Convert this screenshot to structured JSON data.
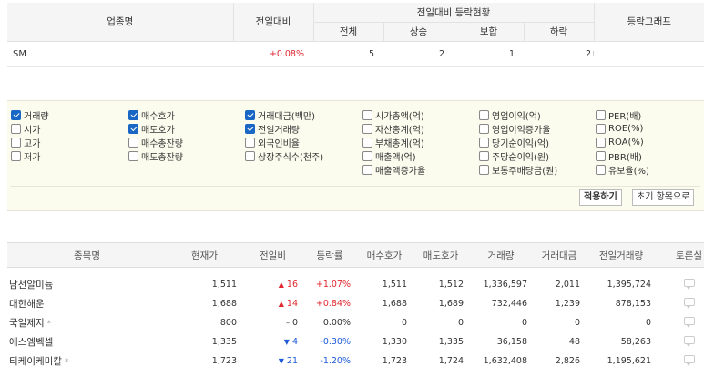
{
  "industry_table": {
    "headers": {
      "name": "업종명",
      "change": "전일대비",
      "group": "전일대비 등락현황",
      "total": "전체",
      "up": "상승",
      "flat": "보합",
      "down": "하락",
      "graph": "등락그래프"
    },
    "row": {
      "name": "SM",
      "change": "+0.08%",
      "total": "5",
      "up": "2",
      "flat": "1",
      "down": "2"
    }
  },
  "options": {
    "columns": [
      [
        {
          "label": "거래량",
          "checked": true
        },
        {
          "label": "시가",
          "checked": false
        },
        {
          "label": "고가",
          "checked": false
        },
        {
          "label": "저가",
          "checked": false
        }
      ],
      [
        {
          "label": "매수호가",
          "checked": true
        },
        {
          "label": "매도호가",
          "checked": true
        },
        {
          "label": "매수총잔량",
          "checked": false
        },
        {
          "label": "매도총잔량",
          "checked": false
        }
      ],
      [
        {
          "label": "거래대금(백만)",
          "checked": true
        },
        {
          "label": "전일거래량",
          "checked": true
        },
        {
          "label": "외국인비율",
          "checked": false
        },
        {
          "label": "상장주식수(천주)",
          "checked": false
        }
      ],
      [
        {
          "label": "시가총액(억)",
          "checked": false
        },
        {
          "label": "자산총계(억)",
          "checked": false
        },
        {
          "label": "부채총계(억)",
          "checked": false
        },
        {
          "label": "매출액(억)",
          "checked": false
        },
        {
          "label": "매출액증가율",
          "checked": false
        }
      ],
      [
        {
          "label": "영업이익(억)",
          "checked": false
        },
        {
          "label": "영업이익증가율",
          "checked": false
        },
        {
          "label": "당기순이익(억)",
          "checked": false
        },
        {
          "label": "주당순이익(원)",
          "checked": false
        },
        {
          "label": "보통주배당금(원)",
          "checked": false
        }
      ],
      [
        {
          "label": "PER(배)",
          "checked": false
        },
        {
          "label": "ROE(%)",
          "checked": false
        },
        {
          "label": "ROA(%)",
          "checked": false
        },
        {
          "label": "PBR(배)",
          "checked": false
        },
        {
          "label": "유보율(%)",
          "checked": false
        }
      ]
    ],
    "apply_label": "적용하기",
    "reset_label": "초기 항목으로"
  },
  "stock_table": {
    "headers": [
      "종목명",
      "현재가",
      "전일비",
      "등락률",
      "매수호가",
      "매도호가",
      "거래량",
      "거래대금",
      "전일거래량",
      "토론실"
    ],
    "rows": [
      {
        "name": "남선알미늄",
        "star": "",
        "price": "1,511",
        "dir": "up",
        "diff": "16",
        "rate": "+1.07%",
        "bid": "1,511",
        "ask": "1,512",
        "vol": "1,336,597",
        "amt": "2,011",
        "prev_vol": "1,395,724"
      },
      {
        "name": "대한해운",
        "star": "",
        "price": "1,688",
        "dir": "up",
        "diff": "14",
        "rate": "+0.84%",
        "bid": "1,688",
        "ask": "1,689",
        "vol": "732,446",
        "amt": "1,239",
        "prev_vol": "878,153"
      },
      {
        "name": "국일제지",
        "star": "*",
        "price": "800",
        "dir": "flat",
        "diff": "0",
        "rate": "0.00%",
        "bid": "0",
        "ask": "0",
        "vol": "0",
        "amt": "0",
        "prev_vol": "0"
      },
      {
        "name": "에스엠벡셀",
        "star": "",
        "price": "1,335",
        "dir": "down",
        "diff": "4",
        "rate": "-0.30%",
        "bid": "1,330",
        "ask": "1,335",
        "vol": "36,158",
        "amt": "48",
        "prev_vol": "58,263"
      },
      {
        "name": "티케이케미칼",
        "star": "*",
        "price": "1,723",
        "dir": "down",
        "diff": "21",
        "rate": "-1.20%",
        "bid": "1,723",
        "ask": "1,724",
        "vol": "1,632,408",
        "amt": "2,826",
        "prev_vol": "1,195,621"
      }
    ],
    "colors": {
      "up": "#e0262e",
      "down": "#1f5bd8"
    }
  }
}
